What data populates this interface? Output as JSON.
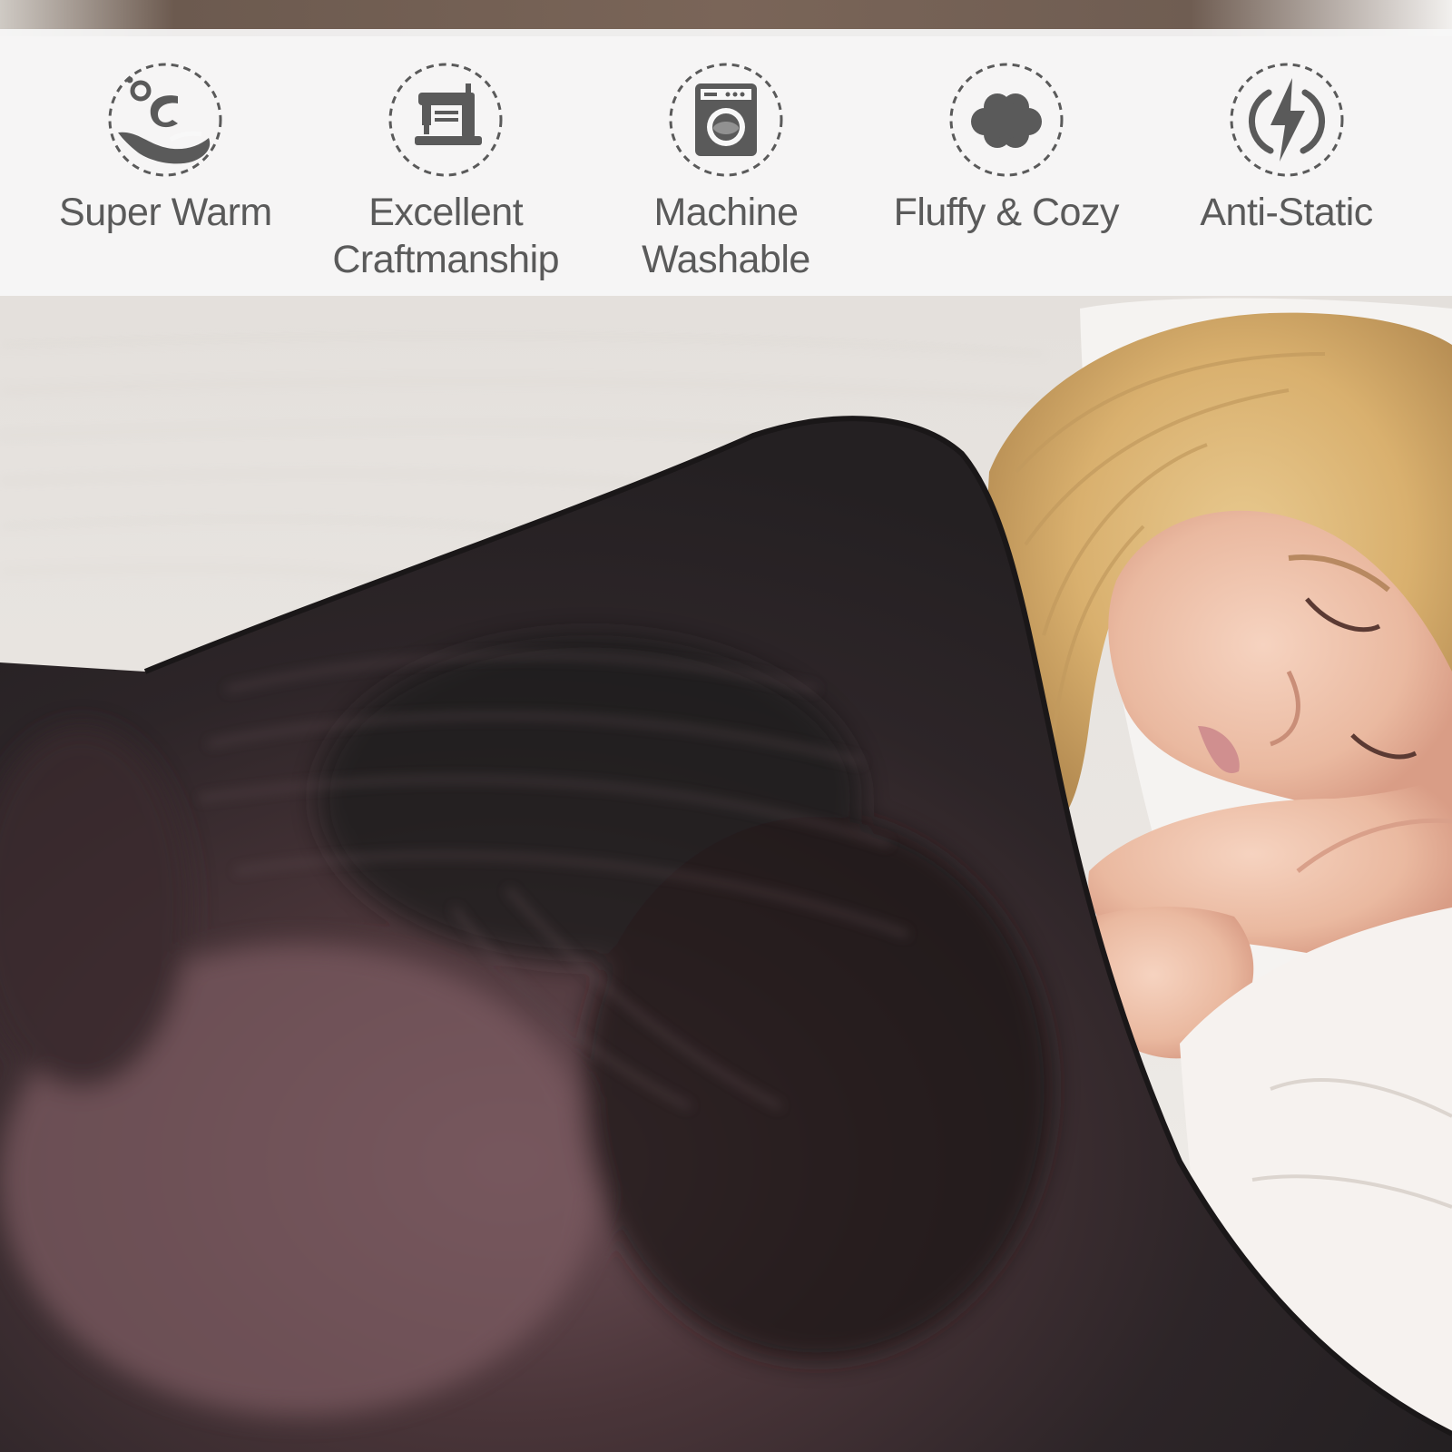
{
  "features": [
    {
      "icon": "sun-cloud-icon",
      "label": "Super Warm"
    },
    {
      "icon": "sewing-machine-icon",
      "label": "Excellent\nCraftmanship"
    },
    {
      "icon": "washing-machine-icon",
      "label": "Machine\nWashable"
    },
    {
      "icon": "cloud-icon",
      "label": "Fluffy & Cozy"
    },
    {
      "icon": "lightning-icon",
      "label": "Anti-Static"
    }
  ],
  "colors": {
    "band": "#f8f8f8",
    "text": "#5a5a5a",
    "icon": "#5a5a5a",
    "blanket": "#2f2a2c",
    "bedding": "#ece8e4"
  },
  "photo": {
    "subject": "sleeping-woman-under-dark-printed-blanket"
  }
}
